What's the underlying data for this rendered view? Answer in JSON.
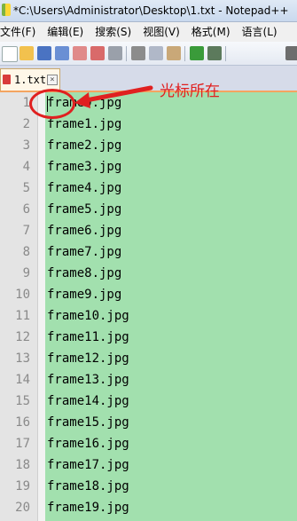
{
  "window": {
    "title": "*C:\\Users\\Administrator\\Desktop\\1.txt - Notepad++"
  },
  "menu": {
    "items": [
      {
        "label": "文件(F)"
      },
      {
        "label": "编辑(E)"
      },
      {
        "label": "搜索(S)"
      },
      {
        "label": "视图(V)"
      },
      {
        "label": "格式(M)"
      },
      {
        "label": "语言(L)"
      }
    ]
  },
  "tabs": [
    {
      "label": "1.txt",
      "close": "×"
    }
  ],
  "editor": {
    "line_numbers": [
      "1",
      "2",
      "3",
      "4",
      "5",
      "6",
      "7",
      "8",
      "9",
      "10",
      "11",
      "12",
      "13",
      "14",
      "15",
      "16",
      "17",
      "18",
      "19",
      "20"
    ],
    "lines": [
      "frame0.jpg",
      "frame1.jpg",
      "frame2.jpg",
      "frame3.jpg",
      "frame4.jpg",
      "frame5.jpg",
      "frame6.jpg",
      "frame7.jpg",
      "frame8.jpg",
      "frame9.jpg",
      "frame10.jpg",
      "frame11.jpg",
      "frame12.jpg",
      "frame13.jpg",
      "frame14.jpg",
      "frame15.jpg",
      "frame16.jpg",
      "frame17.jpg",
      "frame18.jpg",
      "frame19.jpg"
    ],
    "highlight_color": "#a2e0ae"
  },
  "annotation": {
    "text": "光标所在",
    "color": "#e02020"
  },
  "toolbar": {
    "icons": [
      "new-file-icon",
      "open-file-icon",
      "save-icon",
      "save-all-icon",
      "close-icon",
      "close-all-icon",
      "print-icon",
      "cut-icon",
      "copy-icon",
      "paste-icon",
      "undo-icon",
      "redo-icon",
      "find-icon"
    ]
  }
}
